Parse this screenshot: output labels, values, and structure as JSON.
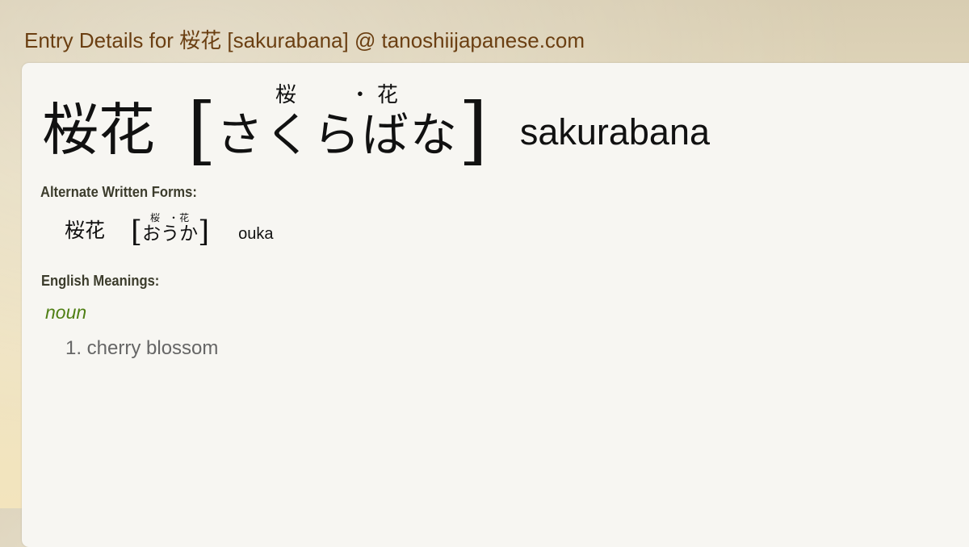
{
  "page": {
    "title": "Entry Details for 桜花 [sakurabana] @ tanoshiijapanese.com"
  },
  "entry": {
    "kanji": "桜花",
    "open_bracket": "[",
    "close_bracket": "]",
    "furigana_1": "桜",
    "furigana_separator": "・",
    "furigana_2": "花",
    "kana": "さくらばな",
    "romaji": "sakurabana"
  },
  "alternate_forms": {
    "label": "Alternate Written Forms:",
    "items": [
      {
        "kanji": "桜花",
        "furigana_1": "桜",
        "furigana_separator": "・",
        "furigana_2": "花",
        "kana": "おうか",
        "romaji": "ouka"
      }
    ]
  },
  "meanings": {
    "label": "English Meanings:",
    "part_of_speech": "noun",
    "items": [
      {
        "text": "1. cherry blossom"
      }
    ]
  },
  "colors": {
    "title": "#6b3f12",
    "part_of_speech": "#4f7f14",
    "meaning_text": "#666666",
    "section_label": "#3c3c2c",
    "panel_bg": "#f7f6f2"
  }
}
